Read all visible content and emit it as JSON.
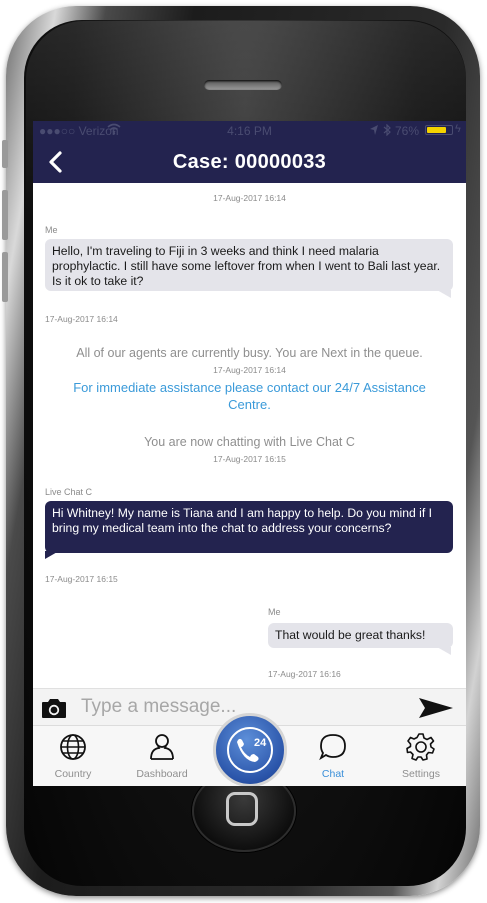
{
  "status_bar": {
    "carrier": "●●●○○ Verizon",
    "time": "4:16 PM",
    "battery": "76%"
  },
  "header": {
    "title": "Case: 00000033",
    "back_icon": "chevron-left-icon"
  },
  "chat": {
    "top_timestamp": "17-Aug-2017 16:14",
    "messages": [
      {
        "sender": "Me",
        "text": "Hello, I'm traveling to Fiji in 3 weeks and think I need malaria prophylactic.  I still have some leftover from when I went to Bali last year. Is it ok to take it?",
        "timestamp": "17-Aug-2017 16:14"
      },
      {
        "sender": "Live Chat C",
        "text": "Hi Whitney! My name is Tiana and I am happy to help. Do you mind if I bring my medical team into the chat to address your concerns?",
        "timestamp": "17-Aug-2017 16:15"
      },
      {
        "sender": "Me",
        "text": "That would be great thanks!",
        "timestamp": "17-Aug-2017 16:16"
      }
    ],
    "system": [
      {
        "text": "All of our agents are currently busy. You are Next in the queue.",
        "timestamp": "17-Aug-2017 16:14"
      },
      {
        "text": "You are now chatting with Live Chat C",
        "timestamp": "17-Aug-2017 16:15"
      }
    ],
    "assistance_link": "For immediate assistance please contact our 24/7 Assistance Centre."
  },
  "composer": {
    "placeholder": "Type a message...",
    "camera_icon": "camera-icon",
    "send_icon": "send-icon"
  },
  "tabs": [
    {
      "label": "Country",
      "icon": "globe-icon"
    },
    {
      "label": "Dashboard",
      "icon": "person-icon"
    },
    {
      "label": "24",
      "icon": "phone-24-icon"
    },
    {
      "label": "Chat",
      "icon": "chat-bubble-icon",
      "active": true
    },
    {
      "label": "Settings",
      "icon": "gear-icon"
    }
  ],
  "colors": {
    "navy": "#23234f",
    "link_blue": "#3a9ad9",
    "bubble_gray": "#e4e4ea"
  }
}
